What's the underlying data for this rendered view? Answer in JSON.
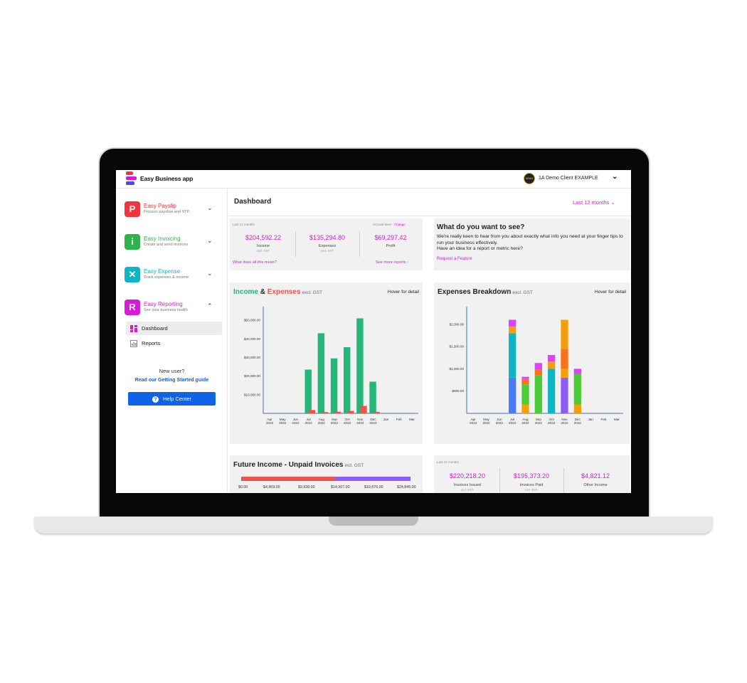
{
  "brand": {
    "logo_text": "Easy Business app"
  },
  "header": {
    "client_name": "1A Demo Client EXAMPLE",
    "avatar_text": "DEMO"
  },
  "sidebar": {
    "apps": [
      {
        "name": "Easy Payslip",
        "sub": "Process payslips and STP",
        "color": "#f0353f",
        "glyph": "P"
      },
      {
        "name": "Easy Invoicing",
        "sub": "Create and send invoices",
        "color": "#2fb24c",
        "glyph": "i"
      },
      {
        "name": "Easy Expense",
        "sub": "Track expenses & income",
        "color": "#10b5c4",
        "glyph": "✕"
      },
      {
        "name": "Easy Reporting",
        "sub": "See your business health",
        "color": "#d81bd8",
        "glyph": "R"
      }
    ],
    "nav": [
      {
        "label": "Dashboard",
        "active": true
      },
      {
        "label": "Reports",
        "active": false
      }
    ],
    "new_user": "New user?",
    "guide_link": "Read our Getting Started guide",
    "help_button": "Help Center"
  },
  "main": {
    "title": "Dashboard",
    "period": "Last 12 months"
  },
  "summary": {
    "period_label": "Last 12 months",
    "view_label": "Accrual View - ",
    "change_link": "Change",
    "income": {
      "value": "$204,592.22",
      "label": "Income",
      "sub": "excl. GST"
    },
    "expenses": {
      "value": "$135,294.80",
      "label": "Expenses",
      "sub": "excl. GST"
    },
    "profit": {
      "value": "$69,297.42",
      "label": "Profit"
    },
    "meaning_link": "What does all this mean?",
    "more_link": "See more reports"
  },
  "what_you_want": {
    "title": "What do you want to see?",
    "text": "We're really keen to hear from you about exactly what info you need at your finger tips to run your business effectively.",
    "text2": "Have an idea for a report or metric here?",
    "link": "Request a Feature"
  },
  "income_expenses": {
    "title_income": "Income",
    "title_amp": " & ",
    "title_expenses": "Expenses",
    "title_small": "excl. GST",
    "hover": "Hover for detail"
  },
  "expenses_breakdown": {
    "title": "Expenses Breakdown",
    "title_small": "excl. GST",
    "hover": "Hover for detail"
  },
  "future_income": {
    "title": "Future Income - Unpaid Invoices",
    "title_small": "incl. GST",
    "ticks": [
      "$0.00",
      "$4,969.00",
      "$9,938.00",
      "$14,907.00",
      "$19,876.00",
      "$24,845.00"
    ]
  },
  "invoices": {
    "period_label": "Last 12 months",
    "issued": {
      "value": "$220,218.20",
      "label": "Invoices Issued",
      "sub": "incl. GST"
    },
    "paid": {
      "value": "$195,373.20",
      "label": "Invoices Paid",
      "sub": "incl. GST"
    },
    "other": {
      "value": "$4,821.12",
      "label": "Other Income"
    }
  },
  "chart_data": [
    {
      "type": "bar",
      "title": "Income & Expenses",
      "categories": [
        "Apr 2022",
        "May 2022",
        "Jun 2022",
        "Jul 2022",
        "Aug 2022",
        "Sep 2022",
        "Oct 2022",
        "Nov 2022",
        "Dec 2022",
        "Jan",
        "Feb",
        "Mar"
      ],
      "series": [
        {
          "name": "Income",
          "color": "#25b67a",
          "values": [
            0,
            0,
            0,
            23500,
            43000,
            29500,
            35500,
            51000,
            17000,
            0,
            0,
            0
          ]
        },
        {
          "name": "Expenses",
          "color": "#ef5350",
          "values": [
            0,
            0,
            0,
            1800,
            700,
            900,
            1300,
            4000,
            800,
            0,
            0,
            0
          ]
        }
      ],
      "yticks": [
        "$10,000.00",
        "$20,000.00",
        "$30,000.00",
        "$40,000.00",
        "$50,000.00"
      ],
      "ylim": [
        0,
        55000
      ]
    },
    {
      "type": "bar",
      "title": "Expenses Breakdown",
      "categories": [
        "Apr 2022",
        "May 2022",
        "Jun 2022",
        "Jul 2022",
        "Aug 2022",
        "Sep 2022",
        "Oct 2022",
        "Nov 2022",
        "Dec 2022",
        "Jan",
        "Feb",
        "Mar"
      ],
      "stacks": [
        [],
        [],
        [],
        [
          {
            "v": 800,
            "c": "#4a7bf7"
          },
          {
            "v": 1000,
            "c": "#10b5c4"
          },
          {
            "v": 150,
            "c": "#f59e0b"
          },
          {
            "v": 150,
            "c": "#d946ef"
          }
        ],
        [
          {
            "v": 200,
            "c": "#f59e0b"
          },
          {
            "v": 450,
            "c": "#4ccc36"
          },
          {
            "v": 120,
            "c": "#f97316"
          },
          {
            "v": 50,
            "c": "#d946ef"
          }
        ],
        [
          {
            "v": 850,
            "c": "#4ccc36"
          },
          {
            "v": 130,
            "c": "#f97316"
          },
          {
            "v": 150,
            "c": "#d946ef"
          }
        ],
        [
          {
            "v": 1000,
            "c": "#10b5c4"
          },
          {
            "v": 160,
            "c": "#f59e0b"
          },
          {
            "v": 150,
            "c": "#d946ef"
          }
        ],
        [
          {
            "v": 800,
            "c": "#8b5cf6"
          },
          {
            "v": 200,
            "c": "#f59e0b"
          },
          {
            "v": 450,
            "c": "#f97316"
          },
          {
            "v": 650,
            "c": "#f59e0b"
          }
        ],
        [
          {
            "v": 200,
            "c": "#f59e0b"
          },
          {
            "v": 680,
            "c": "#4ccc36"
          },
          {
            "v": 120,
            "c": "#d946ef"
          }
        ],
        [],
        [],
        []
      ],
      "yticks": [
        "$500.00",
        "$1,000.00",
        "$1,500.00",
        "$2,000.00"
      ],
      "ylim": [
        0,
        2300
      ]
    }
  ]
}
